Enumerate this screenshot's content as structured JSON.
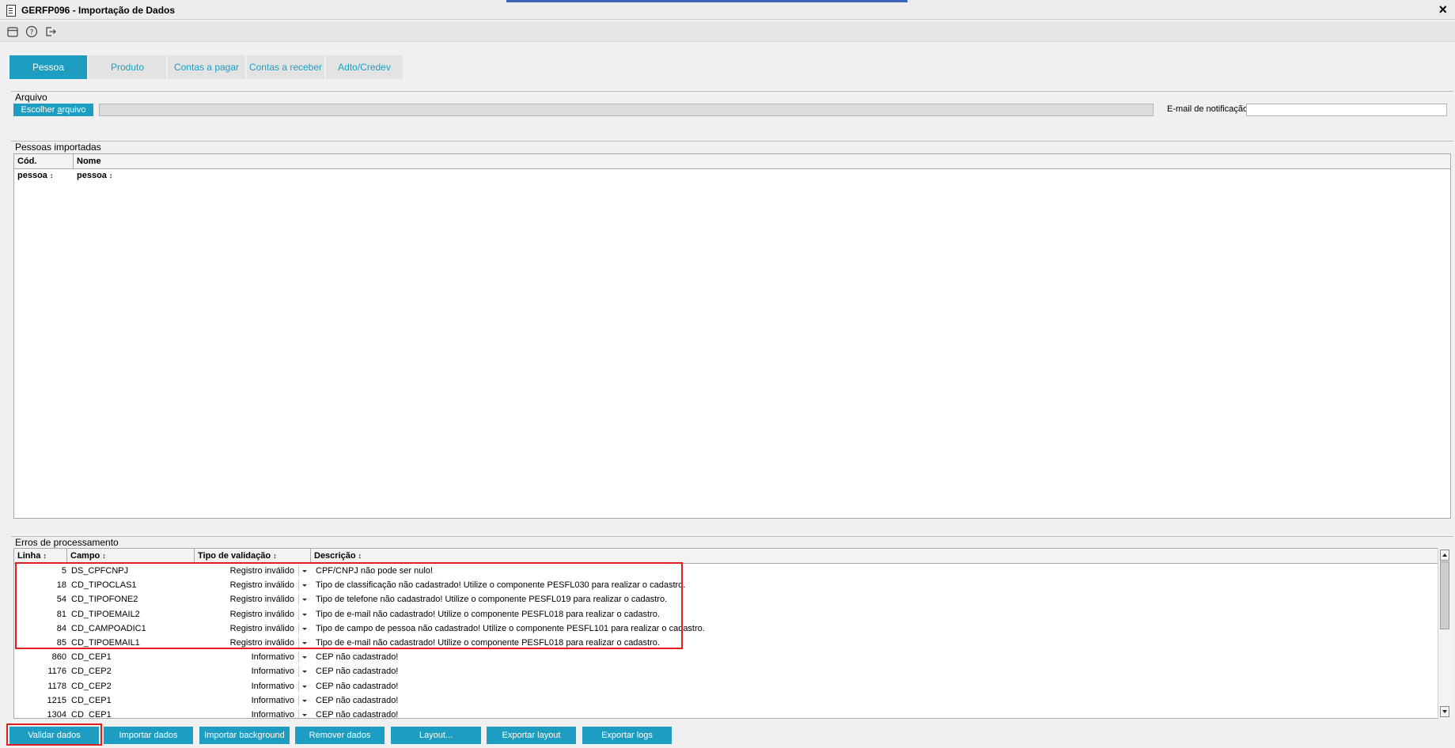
{
  "window": {
    "title": "GERFP096 - Importação de Dados",
    "close": "×"
  },
  "toolbar": {
    "icons": [
      "calendar-icon",
      "help-icon",
      "exit-icon"
    ]
  },
  "tabs": [
    {
      "label": "Pessoa",
      "active": true
    },
    {
      "label": "Produto",
      "active": false
    },
    {
      "label": "Contas a pagar",
      "active": false
    },
    {
      "label": "Contas a receber",
      "active": false
    },
    {
      "label": "Adto/Credev",
      "active": false
    }
  ],
  "arquivo": {
    "title": "Arquivo",
    "choose_prefix": "Escolher ",
    "choose_underlined": "a",
    "choose_suffix": "rquivo",
    "file_path": "",
    "email_label": "E-mail de notificação",
    "email_value": ""
  },
  "pessoas": {
    "title": "Pessoas importadas",
    "columns": [
      "Cód. pessoa",
      "Nome pessoa"
    ],
    "rows": []
  },
  "erros": {
    "title": "Erros de processamento",
    "columns": [
      "Linha",
      "Campo",
      "Tipo de validação",
      "Descrição"
    ],
    "rows": [
      {
        "linha": "5",
        "campo": "DS_CPFCNPJ",
        "tipo": "Registro inválido",
        "descricao": "CPF/CNPJ não pode ser nulo!"
      },
      {
        "linha": "18",
        "campo": "CD_TIPOCLAS1",
        "tipo": "Registro inválido",
        "descricao": "Tipo de classificação não cadastrado! Utilize o componente PESFL030 para realizar o cadastro."
      },
      {
        "linha": "54",
        "campo": "CD_TIPOFONE2",
        "tipo": "Registro inválido",
        "descricao": "Tipo de telefone não cadastrado! Utilize o componente PESFL019 para realizar o cadastro."
      },
      {
        "linha": "81",
        "campo": "CD_TIPOEMAIL2",
        "tipo": "Registro inválido",
        "descricao": "Tipo de e-mail não cadastrado! Utilize o componente PESFL018 para realizar o cadastro."
      },
      {
        "linha": "84",
        "campo": "CD_CAMPOADIC1",
        "tipo": "Registro inválido",
        "descricao": "Tipo de campo de pessoa não cadastrado! Utilize o componente PESFL101 para realizar o cadastro."
      },
      {
        "linha": "85",
        "campo": "CD_TIPOEMAIL1",
        "tipo": "Registro inválido",
        "descricao": "Tipo de e-mail não cadastrado! Utilize o componente PESFL018 para realizar o cadastro."
      },
      {
        "linha": "860",
        "campo": "CD_CEP1",
        "tipo": "Informativo",
        "descricao": "CEP não cadastrado!"
      },
      {
        "linha": "1176",
        "campo": "CD_CEP2",
        "tipo": "Informativo",
        "descricao": "CEP não cadastrado!"
      },
      {
        "linha": "1178",
        "campo": "CD_CEP2",
        "tipo": "Informativo",
        "descricao": "CEP não cadastrado!"
      },
      {
        "linha": "1215",
        "campo": "CD_CEP1",
        "tipo": "Informativo",
        "descricao": "CEP não cadastrado!"
      },
      {
        "linha": "1304",
        "campo": "CD_CEP1",
        "tipo": "Informativo",
        "descricao": "CEP não cadastrado!"
      }
    ]
  },
  "buttons": [
    {
      "label": "Validar dados",
      "name": "validar-dados-button"
    },
    {
      "label": "Importar dados",
      "name": "importar-dados-button"
    },
    {
      "label": "Importar background",
      "name": "importar-background-button"
    },
    {
      "label": "Remover dados",
      "name": "remover-dados-button"
    },
    {
      "label": "Layout...",
      "name": "layout-button"
    },
    {
      "label": "Exportar layout",
      "name": "exportar-layout-button"
    },
    {
      "label": "Exportar logs",
      "name": "exportar-logs-button"
    }
  ],
  "colors": {
    "accent": "#1d9dc1",
    "highlight": "#e02020"
  }
}
